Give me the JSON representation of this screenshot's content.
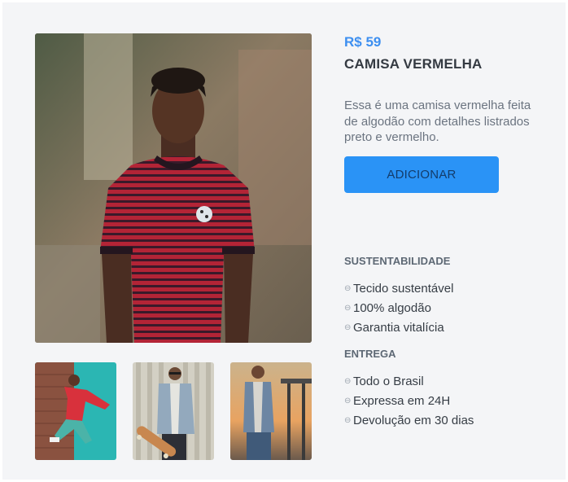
{
  "product": {
    "price": "R$ 59",
    "name": "CAMISA VERMELHA",
    "description": "Essa é uma camisa vermelha feita de algodão com detalhes listrados preto e vermelho.",
    "add_button_label": "ADICIONAR"
  },
  "gallery": {
    "main_image_icon": "photo-man-striped-red-shirt",
    "thumbnails": [
      "photo-skater-red-hoodie",
      "photo-man-denim-jacket-skateboard",
      "photo-man-denim-jacket-sunset"
    ]
  },
  "sustentabilidade": {
    "heading": "SUSTENTABILIDADE",
    "items": [
      "Tecido sustentável",
      "100% algodão",
      "Garantia vitalícia"
    ]
  },
  "entrega": {
    "heading": "ENTREGA",
    "items": [
      "Todo o Brasil",
      "Expressa em 24H",
      "Devolução em 30 dias"
    ]
  },
  "colors": {
    "accent": "#2a93f6",
    "price": "#3d8ff0",
    "background": "#f4f5f7"
  }
}
